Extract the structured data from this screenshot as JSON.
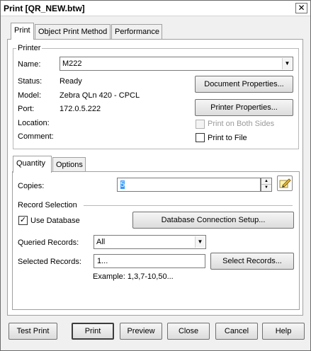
{
  "window": {
    "title": "Print [QR_NEW.btw]"
  },
  "tabs": [
    "Print",
    "Object Print Method",
    "Performance"
  ],
  "printer": {
    "legend": "Printer",
    "name_label": "Name:",
    "name_value": "M222",
    "status_label": "Status:",
    "status_value": "Ready",
    "model_label": "Model:",
    "model_value": "Zebra QLn 420 - CPCL",
    "port_label": "Port:",
    "port_value": "172.0.5.222",
    "location_label": "Location:",
    "comment_label": "Comment:",
    "doc_props_button": "Document Properties...",
    "printer_props_button": "Printer Properties...",
    "both_sides_label": "Print on Both Sides",
    "both_sides_checked": false,
    "print_to_file_label": "Print to File",
    "print_to_file_checked": false
  },
  "subtabs": [
    "Quantity",
    "Options"
  ],
  "quantity": {
    "copies_label": "Copies:",
    "copies_value": "5",
    "record_selection_label": "Record Selection",
    "use_database_label": "Use Database",
    "use_database_checked": true,
    "db_setup_button": "Database Connection Setup...",
    "queried_records_label": "Queried Records:",
    "queried_records_value": "All",
    "selected_records_label": "Selected Records:",
    "selected_records_value": "1...",
    "select_records_button": "Select Records...",
    "example_text": "Example: 1,3,7-10,50..."
  },
  "footer": {
    "test_print": "Test Print",
    "print": "Print",
    "preview": "Preview",
    "close": "Close",
    "cancel": "Cancel",
    "help": "Help"
  }
}
